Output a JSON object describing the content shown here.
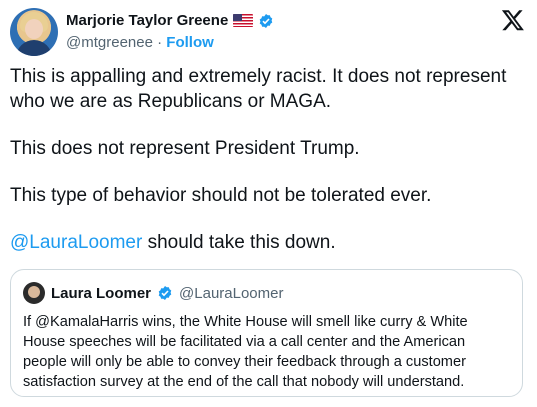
{
  "author": {
    "name": "Marjorie Taylor Greene",
    "flag_icon": "us-flag-icon",
    "handle": "@mtgreenee",
    "separator": "·",
    "follow_label": "Follow"
  },
  "platform_icon": "x-logo-icon",
  "tweet": {
    "paragraph1": "This is appalling and extremely racist.  It does not represent who we are as Republicans or MAGA.",
    "paragraph2": "This does not represent President Trump.",
    "paragraph3": "This type of behavior should not be tolerated ever.",
    "mention": "@LauraLoomer",
    "paragraph4_rest": " should take this down."
  },
  "quoted": {
    "name": "Laura Loomer",
    "handle": "@LauraLoomer",
    "text": "If @KamalaHarris wins, the White House will smell like curry & White House speeches will be facilitated via a call center and the American people will only be able to convey their feedback through a customer satisfaction survey at the end of the call that nobody will understand."
  },
  "colors": {
    "accent": "#1d9bf0",
    "secondary_text": "#536471",
    "border": "#cfd9de"
  }
}
